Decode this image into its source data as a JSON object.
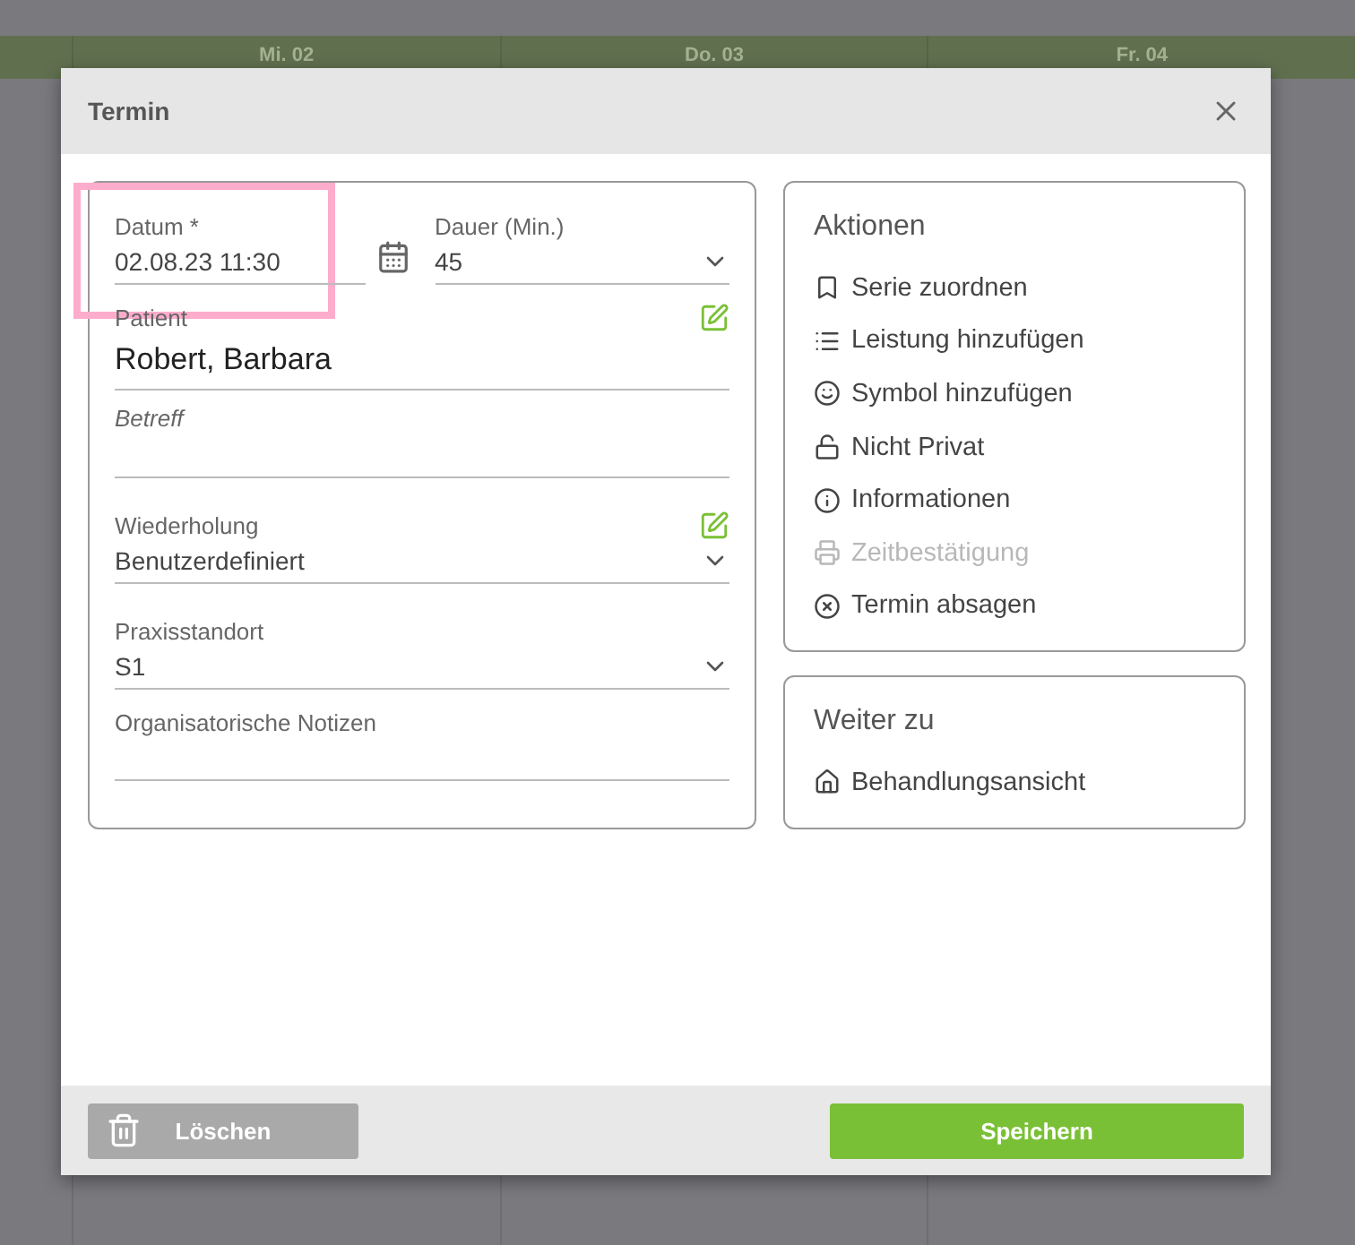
{
  "calendar": {
    "days": [
      "Mi. 02",
      "Do. 03",
      "Fr. 04"
    ]
  },
  "dialog": {
    "title": "Termin",
    "fields": [
      {
        "kind": "date",
        "label": "Datum",
        "required": "*",
        "value": "02.08.23 11:30",
        "highlighted": true
      },
      {
        "kind": "select",
        "label": "Dauer (Min.)",
        "value": "45"
      },
      {
        "kind": "text",
        "label": "Patient",
        "value": "Robert, Barbara",
        "editable": true
      },
      {
        "kind": "text",
        "placeholder": "Betreff"
      },
      {
        "kind": "select",
        "label": "Wiederholung",
        "value": "Benutzerdefiniert",
        "editable": true
      },
      {
        "kind": "select",
        "label": "Praxisstandort",
        "value": "S1"
      },
      {
        "kind": "text",
        "label": "Organisatorische Notizen"
      }
    ],
    "actions": {
      "title": "Aktionen",
      "items": [
        {
          "label": "Serie zuordnen",
          "disabled": false
        },
        {
          "label": "Leistung hinzufügen",
          "disabled": false
        },
        {
          "label": "Symbol hinzufügen",
          "disabled": false
        },
        {
          "label": "Nicht Privat",
          "disabled": false
        },
        {
          "label": "Informationen",
          "disabled": false
        },
        {
          "label": "Zeitbestätigung",
          "disabled": true
        },
        {
          "label": "Termin absagen",
          "disabled": false
        }
      ]
    },
    "goto": {
      "title": "Weiter zu",
      "items": [
        {
          "label": "Behandlungsansicht",
          "disabled": false
        }
      ]
    },
    "buttons": [
      {
        "kind": "delete",
        "label": "Löschen"
      },
      {
        "kind": "save",
        "label": "Speichern"
      }
    ]
  }
}
